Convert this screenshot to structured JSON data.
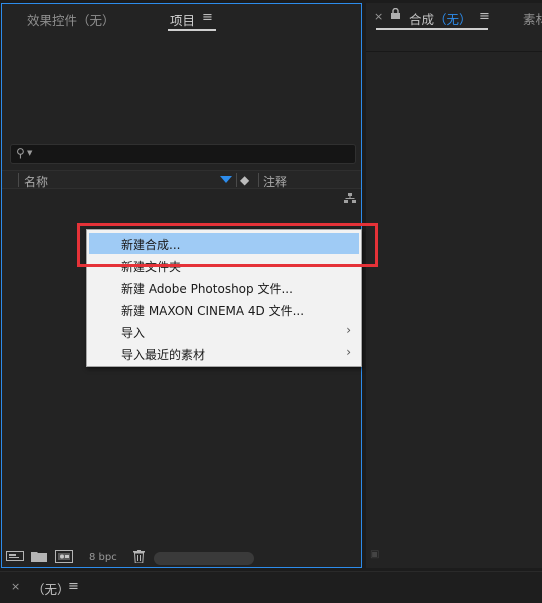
{
  "project_panel": {
    "tabs": {
      "effects_controls": "效果控件（无）",
      "project": "项目"
    },
    "menu_icon": "≡",
    "search": {
      "icon": "search-icon",
      "value": ""
    },
    "columns": {
      "name": "名称",
      "comment": "注释"
    },
    "bottom_toolbar": {
      "bpc": "8 bpc"
    }
  },
  "composition_panel": {
    "title": "合成",
    "title_none": "（无）",
    "menu_icon": "≡",
    "next_tab": "素材"
  },
  "timeline": {
    "title": "（无）",
    "menu_icon": "≡"
  },
  "context_menu": {
    "items": [
      {
        "label": "新建合成...",
        "highlighted": true,
        "submenu": false
      },
      {
        "label": "新建文件夹",
        "highlighted": false,
        "submenu": false
      },
      {
        "label": "新建 Adobe Photoshop 文件...",
        "highlighted": false,
        "submenu": false
      },
      {
        "label": "新建 MAXON CINEMA 4D 文件...",
        "highlighted": false,
        "submenu": false
      },
      {
        "label": "导入",
        "highlighted": false,
        "submenu": true
      },
      {
        "label": "导入最近的素材",
        "highlighted": false,
        "submenu": true
      }
    ],
    "submenu_arrow": "›"
  },
  "colors": {
    "accent": "#2d8ceb",
    "highlight_box": "#e53238",
    "menu_hover": "#9fcbf5"
  }
}
